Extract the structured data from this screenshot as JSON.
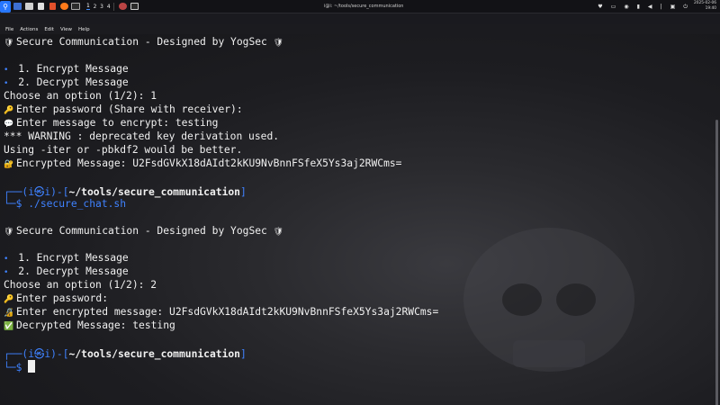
{
  "panel": {
    "workspaces": [
      "1",
      "2",
      "3",
      "4"
    ],
    "window_title": "i@i: ~/tools/secure_communication",
    "clock_date": "2025-02-06",
    "clock_time": "19:40"
  },
  "menu": [
    "File",
    "Actions",
    "Edit",
    "View",
    "Help"
  ],
  "terminal": {
    "header1": "Secure Communication - Designed by YogSec",
    "opt1": "1. Encrypt Message",
    "opt2": "2. Decrypt Message",
    "choose1": "Choose an option (1/2): 1",
    "pw1": "Enter password (Share with receiver):",
    "msg": "Enter message to encrypt: testing",
    "warn1": "*** WARNING : deprecated key derivation used.",
    "warn2": "Using -iter or -pbkdf2 would be better.",
    "enc": "Encrypted Message: U2FsdGVkX18dAIdt2kKU9NvBnnFSfeX5Ys3aj2RWCms=",
    "prompt_user": "(i",
    "prompt_at": "㉿",
    "prompt_host": "i)-[",
    "prompt_dir": "~/tools/secure_communication",
    "prompt_close": "]",
    "cmd": "./secure_chat.sh",
    "header2": "Secure Communication - Designed by YogSec",
    "opt1b": "1. Encrypt Message",
    "opt2b": "2. Decrypt Message",
    "choose2": "Choose an option (1/2): 2",
    "pw2": "Enter password:",
    "encin": "Enter encrypted message: U2FsdGVkX18dAIdt2kKU9NvBnnFSfeX5Ys3aj2RWCms=",
    "dec": "Decrypted Message: testing"
  }
}
